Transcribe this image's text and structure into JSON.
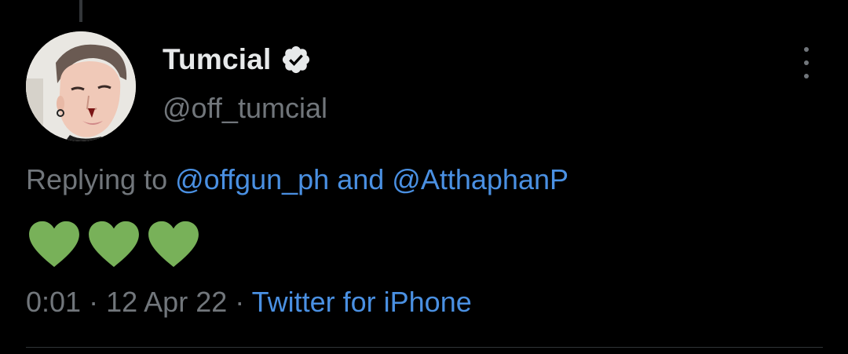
{
  "author": {
    "display_name": "Tumcial",
    "handle": "@off_tumcial",
    "verified": true
  },
  "reply": {
    "prefix": "Replying to",
    "mention_1": "@offgun_ph",
    "joiner": "and",
    "mention_2": "@AtthaphanP"
  },
  "content": {
    "emojis": [
      "green-heart",
      "green-heart",
      "green-heart"
    ]
  },
  "meta": {
    "time": "0:01",
    "separator_1": "·",
    "date": "12 Apr 22",
    "separator_2": "·",
    "source": "Twitter for iPhone"
  },
  "colors": {
    "background": "#000000",
    "primary_text": "#e7e9ea",
    "secondary_text": "#71767b",
    "link": "#4a90e2",
    "heart": "#78b159"
  },
  "icons": {
    "verified": "verified-badge-icon",
    "more": "more-options-icon"
  }
}
